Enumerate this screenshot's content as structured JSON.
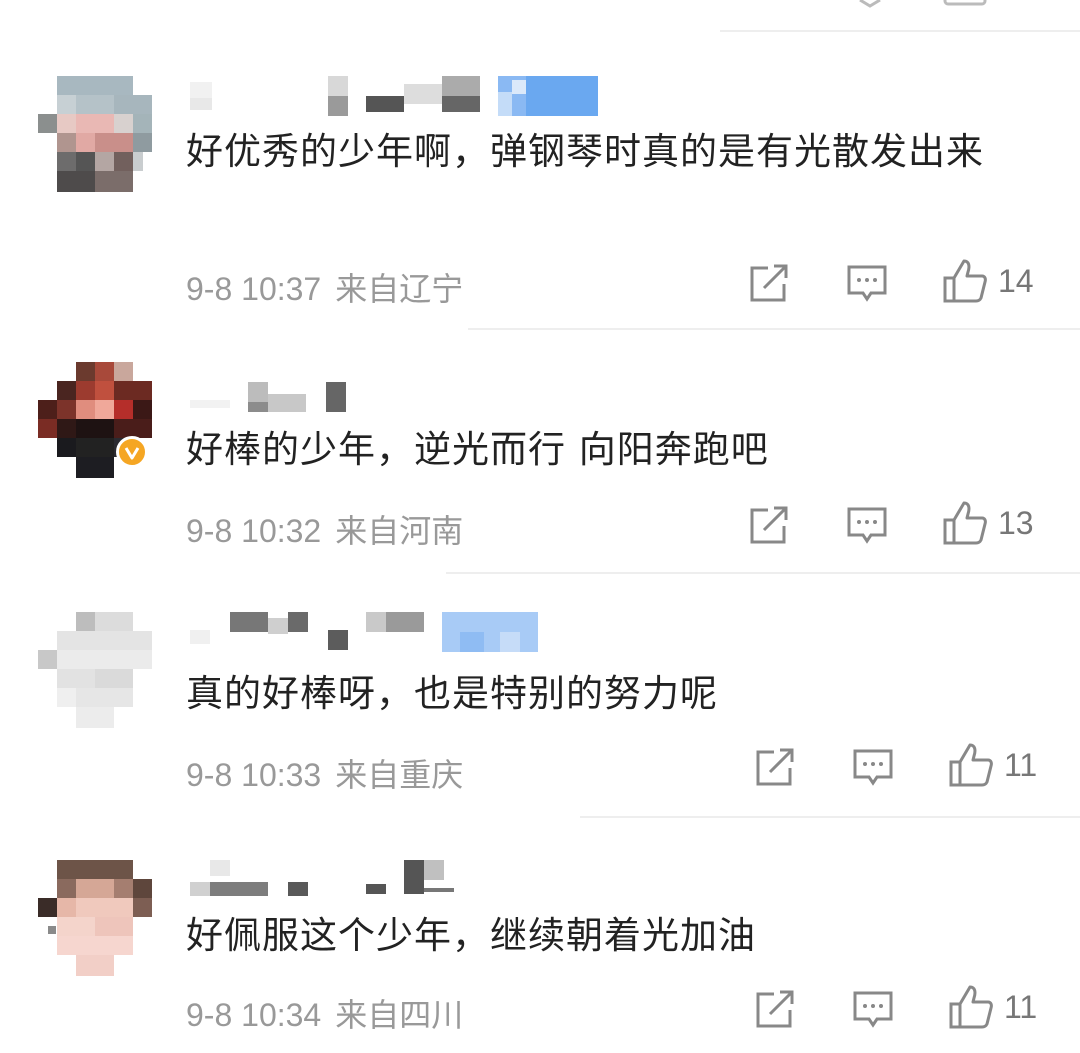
{
  "comments": [
    {
      "text": "好优秀的少年啊，弹钢琴时真的是有光散发出来",
      "time": "9-8 10:37",
      "location": "来自辽宁",
      "likes": "14",
      "verified": false
    },
    {
      "text": "好棒的少年，逆光而行 向阳奔跑吧",
      "time": "9-8 10:32",
      "location": "来自河南",
      "likes": "13",
      "verified": true
    },
    {
      "text": "真的好棒呀，也是特别的努力呢",
      "time": "9-8 10:33",
      "location": "来自重庆",
      "likes": "11",
      "verified": false
    },
    {
      "text": "好佩服这个少年，继续朝着光加油",
      "time": "9-8 10:34",
      "location": "来自四川",
      "likes": "11",
      "verified": false
    }
  ],
  "icons": {
    "share": "share-icon",
    "reply": "comment-icon",
    "like": "thumbs-up-icon",
    "verified": "verified-badge-icon"
  },
  "colors": {
    "text": "#222222",
    "meta": "#999999",
    "verified": "#f5a623",
    "name_blue": "#6aa8f0"
  }
}
